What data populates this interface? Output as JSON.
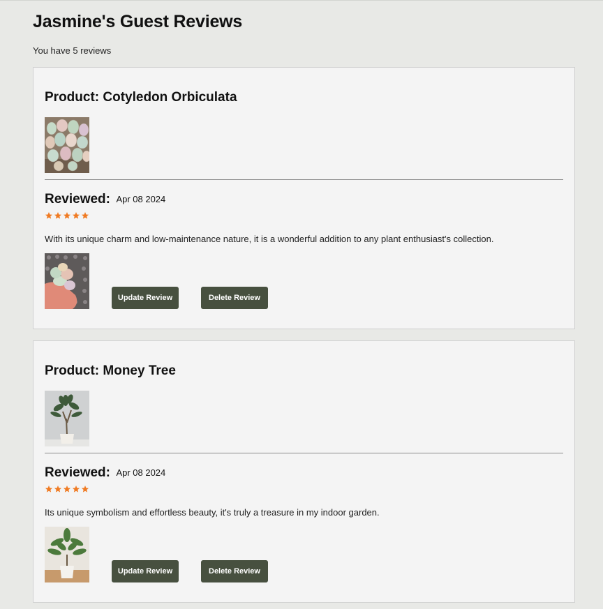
{
  "page": {
    "title": "Jasmine's Guest Reviews",
    "count_text": "You have 5 reviews"
  },
  "reviews": [
    {
      "product_title": "Product: Cotyledon Orbiculata",
      "reviewed_label": "Reviewed:",
      "date": "Apr 08 2024",
      "rating": 5,
      "comment": "With its unique charm and low-maintenance nature, it is a wonderful addition to any plant enthusiast's collection.",
      "update_label": "Update Review",
      "delete_label": "Delete Review"
    },
    {
      "product_title": "Product: Money Tree",
      "reviewed_label": "Reviewed:",
      "date": "Apr 08 2024",
      "rating": 5,
      "comment": "Its unique symbolism and effortless beauty, it's truly a treasure in my indoor garden.",
      "update_label": "Update Review",
      "delete_label": "Delete Review"
    }
  ],
  "colors": {
    "background": "#e8e9e6",
    "card": "#f4f4f4",
    "button": "#47503f",
    "star": "#f07a22"
  }
}
